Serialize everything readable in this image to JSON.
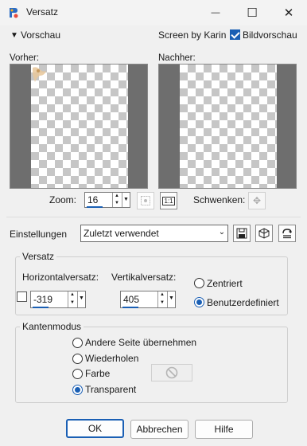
{
  "window": {
    "title": "Versatz",
    "minimize_glyph": "—",
    "maximize_glyph": "☐",
    "close_glyph": "✕"
  },
  "preview_header": {
    "toggle_label": "Vorschau",
    "credit": "Screen by Karin",
    "bildvorschau_label": "Bildvorschau",
    "bildvorschau_checked": true
  },
  "panes": {
    "before_label": "Vorher:",
    "after_label": "Nachher:"
  },
  "zoom": {
    "label": "Zoom:",
    "value": "16",
    "zoom_fit_icon": "zoom-fit-icon",
    "actual_size_label": "1:1",
    "pan_label": "Schwenken:",
    "pan_icon": "move-icon"
  },
  "settings": {
    "label": "Einstellungen",
    "value": "Zuletzt verwendet"
  },
  "versatz": {
    "title": "Versatz",
    "h_label": "Horizontalversatz:",
    "h_value": "-319",
    "v_label": "Vertikalversatz:",
    "v_value": "405",
    "centered_label": "Zentriert",
    "custom_label": "Benutzerdefiniert",
    "selected": "custom"
  },
  "kantenmodus": {
    "title": "Kantenmodus",
    "options": [
      "Andere Seite übernehmen",
      "Wiederholen",
      "Farbe",
      "Transparent"
    ],
    "selected": "Transparent"
  },
  "buttons": {
    "ok": "OK",
    "cancel": "Abbrechen",
    "help": "Hilfe"
  },
  "colors": {
    "accent": "#1a5fb4",
    "pane_gray": "#6e6e6e"
  }
}
